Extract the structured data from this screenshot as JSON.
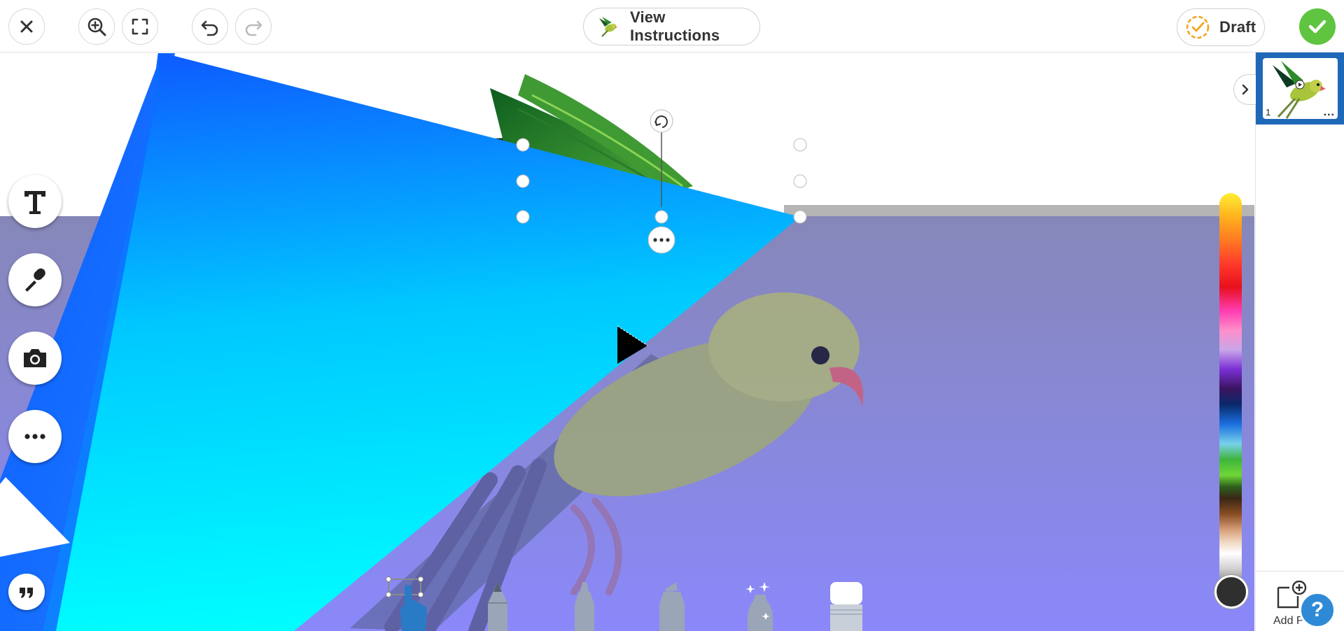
{
  "toolbar": {
    "close_icon": "close-icon",
    "zoom_icon": "zoom-in-icon",
    "fullscreen_icon": "fullscreen-icon",
    "undo_icon": "undo-icon",
    "redo_icon": "redo-icon",
    "instructions_label": "View Instructions",
    "draft_label": "Draft",
    "done_icon": "check-icon"
  },
  "tools": [
    {
      "name": "text-tool",
      "icon": "text-icon"
    },
    {
      "name": "microphone-tool",
      "icon": "microphone-icon"
    },
    {
      "name": "camera-tool",
      "icon": "camera-icon"
    },
    {
      "name": "more-tools",
      "icon": "more-icon"
    },
    {
      "name": "quote-tool",
      "icon": "quote-icon"
    }
  ],
  "brushes": [
    "select-hand",
    "pencil",
    "pen",
    "marker",
    "glitter",
    "eraser"
  ],
  "palette": {
    "selected_color": "#2f2f2f"
  },
  "colors": {
    "accent": "#1f68b8",
    "done": "#5fc43f",
    "draft_ring": "#f5a623",
    "shape_fill_top": "#0a4fff",
    "shape_fill_bottom": "#00f0ff",
    "overlay": "#6f70ff"
  },
  "pages": {
    "items": [
      {
        "number": "1",
        "more_label": "..."
      }
    ],
    "add_page_label": "Add P"
  },
  "help_label": "?"
}
